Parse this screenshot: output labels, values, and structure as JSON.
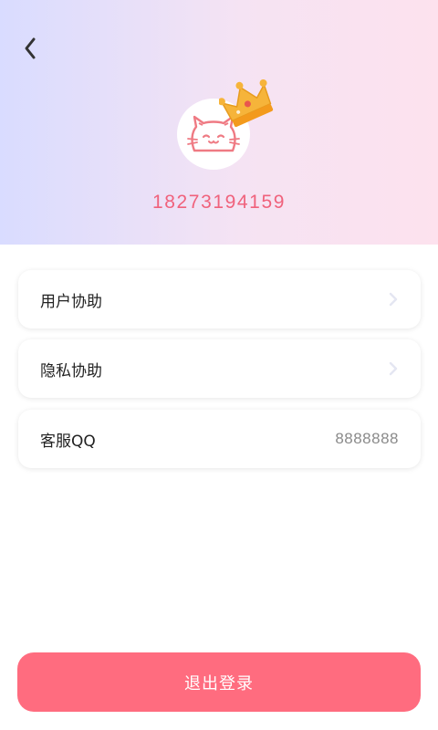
{
  "header": {
    "phone": "18273194159"
  },
  "icons": {
    "back": "chevron-left-icon",
    "avatar": "cat-face-icon",
    "crown": "crown-icon",
    "row_arrow": "chevron-right-icon"
  },
  "menu": {
    "items": [
      {
        "label": "用户协助",
        "value": ""
      },
      {
        "label": "隐私协助",
        "value": ""
      },
      {
        "label": "客服QQ",
        "value": "8888888"
      }
    ]
  },
  "footer": {
    "logout_label": "退出登录"
  },
  "colors": {
    "accent": "#ff6c7f",
    "phone_text": "#f0627c",
    "header_left": "#d9dcff",
    "header_right": "#fde2ee",
    "crown": "#f6b43a"
  }
}
